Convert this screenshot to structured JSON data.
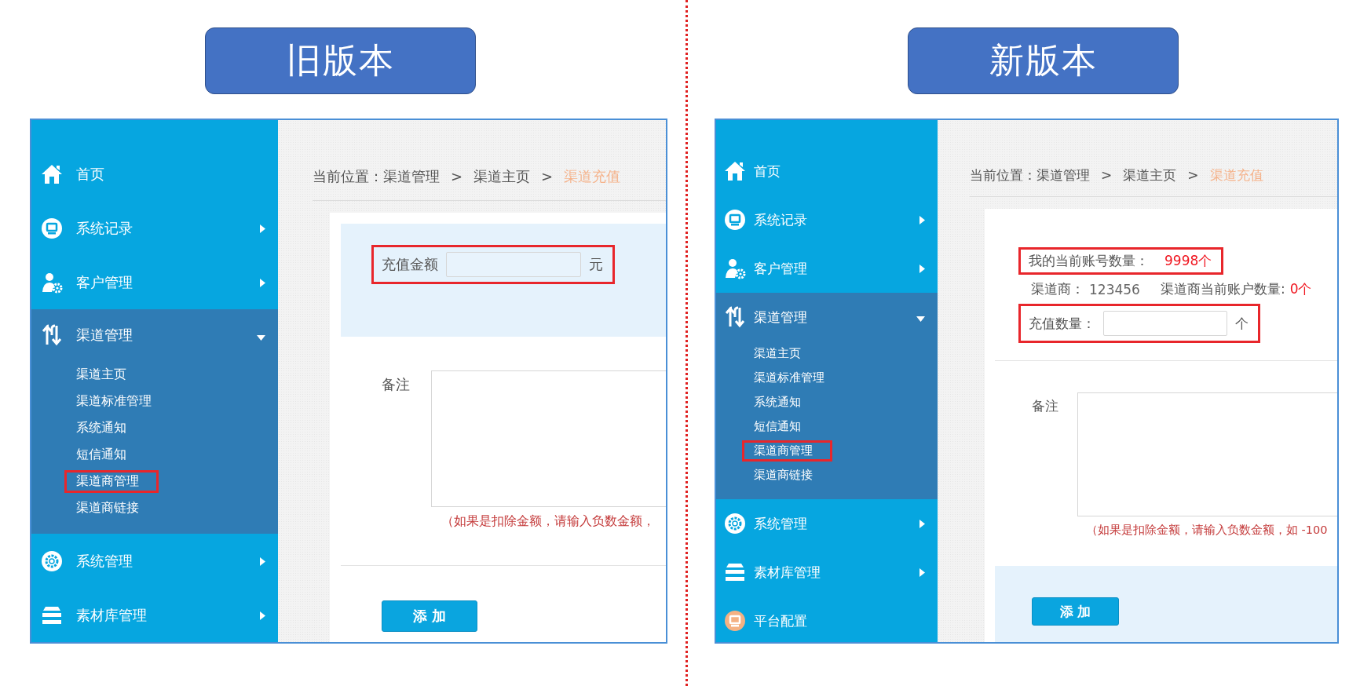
{
  "versions": [
    {
      "title": "旧版本",
      "sidebar": [
        {
          "label": "首页"
        },
        {
          "label": "系统记录",
          "expanded": false
        },
        {
          "label": "客户管理",
          "expanded": false
        },
        {
          "label": "渠道管理",
          "expanded": true,
          "children": [
            {
              "label": "渠道主页",
              "highlighted": false
            },
            {
              "label": "渠道标准管理",
              "highlighted": false
            },
            {
              "label": "系统通知",
              "highlighted": false
            },
            {
              "label": "短信通知",
              "highlighted": false
            },
            {
              "label": "渠道商管理",
              "highlighted": true
            },
            {
              "label": "渠道商链接",
              "highlighted": false
            }
          ]
        },
        {
          "label": "系统管理",
          "expanded": false
        },
        {
          "label": "素材库管理",
          "expanded": false
        }
      ],
      "breadcrumb": [
        {
          "kind": "crumb",
          "label": "当前位置：渠道管理",
          "current": false
        },
        {
          "kind": "separator",
          "label": ">"
        },
        {
          "kind": "crumb",
          "label": "渠道主页",
          "current": false
        },
        {
          "kind": "separator",
          "label": ">"
        },
        {
          "kind": "crumb",
          "label": "渠道充值",
          "current": true
        }
      ],
      "form": {
        "top_shaded": true,
        "rows": [
          {
            "kind": "field",
            "label": "充值金额",
            "unit": "元",
            "highlighted": true
          }
        ],
        "remark_label": "备注",
        "hint": "（如果是扣除金额，请输入负数金额，",
        "footer_shaded": false,
        "button": "添 加"
      }
    },
    {
      "title": "新版本",
      "sidebar": [
        {
          "label": "首页"
        },
        {
          "label": "系统记录",
          "expanded": false
        },
        {
          "label": "客户管理",
          "expanded": false
        },
        {
          "label": "渠道管理",
          "expanded": true,
          "children": [
            {
              "label": "渠道主页",
              "highlighted": false
            },
            {
              "label": "渠道标准管理",
              "highlighted": false
            },
            {
              "label": "系统通知",
              "highlighted": false
            },
            {
              "label": "短信通知",
              "highlighted": false
            },
            {
              "label": "渠道商管理",
              "highlighted": true
            },
            {
              "label": "渠道商链接",
              "highlighted": false
            }
          ]
        },
        {
          "label": "系统管理",
          "expanded": false
        },
        {
          "label": "素材库管理",
          "expanded": false
        },
        {
          "label": "平台配置"
        }
      ],
      "breadcrumb": [
        {
          "kind": "crumb",
          "label": "当前位置：渠道管理",
          "current": false
        },
        {
          "kind": "separator",
          "label": ">"
        },
        {
          "kind": "crumb",
          "label": "渠道主页",
          "current": false
        },
        {
          "kind": "separator",
          "label": ">"
        },
        {
          "kind": "crumb",
          "label": "渠道充值",
          "current": true
        }
      ],
      "form": {
        "top_shaded": false,
        "rows": [
          {
            "kind": "stat",
            "highlighted": true,
            "items": [
              {
                "label": "我的当前账号数量：",
                "value": "9998个",
                "alert": true
              }
            ]
          },
          {
            "kind": "stat",
            "highlighted": false,
            "items": [
              {
                "label": "渠道商：",
                "value": "123456",
                "alert": false
              },
              {
                "label": "渠道商当前账户数量:",
                "value": "0个",
                "alert": true
              }
            ]
          },
          {
            "kind": "field",
            "label": "充值数量：",
            "unit": "个",
            "highlighted": true
          }
        ],
        "remark_label": "备注",
        "hint": "（如果是扣除金额，请输入负数金额，如 -100",
        "footer_shaded": true,
        "button": "添 加"
      }
    }
  ]
}
